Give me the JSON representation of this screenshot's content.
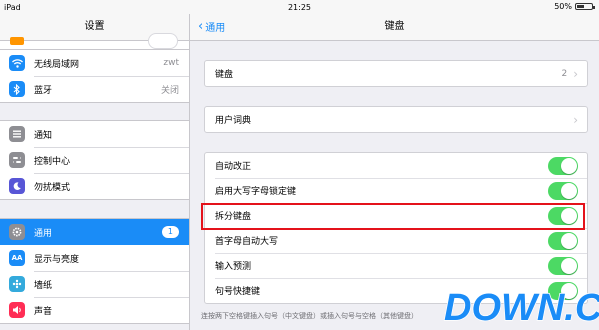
{
  "status": {
    "device": "iPad",
    "time": "21:25",
    "battery": "50%",
    "battery_level": 0.5
  },
  "sidebar": {
    "title": "设置",
    "items": [
      {
        "label": "无线局域网",
        "value": "zwt",
        "icon": "wifi-icon",
        "color": "#1a8cf7"
      },
      {
        "label": "蓝牙",
        "value": "关闭",
        "icon": "bluetooth-icon",
        "color": "#1a8cf7"
      },
      {
        "label": "通知",
        "icon": "notifications-icon",
        "color": "#8e8e93"
      },
      {
        "label": "控制中心",
        "icon": "control-center-icon",
        "color": "#8e8e93"
      },
      {
        "label": "勿扰模式",
        "icon": "moon-icon",
        "color": "#5856d6"
      },
      {
        "label": "通用",
        "badge": "1",
        "icon": "gear-icon",
        "color": "#8e8e93"
      },
      {
        "label": "显示与亮度",
        "icon": "display-icon",
        "color": "#1a8cf7"
      },
      {
        "label": "墙纸",
        "icon": "wallpaper-icon",
        "color": "#34aadc"
      },
      {
        "label": "声音",
        "icon": "sound-icon",
        "color": "#ff2d55"
      }
    ]
  },
  "detail": {
    "back_label": "通用",
    "title": "键盘",
    "keyboards": {
      "label": "键盘",
      "value": "2"
    },
    "dictionary": {
      "label": "用户词典"
    },
    "toggles": [
      {
        "label": "自动改正",
        "on": true
      },
      {
        "label": "启用大写字母锁定键",
        "on": true
      },
      {
        "label": "拆分键盘",
        "on": true
      },
      {
        "label": "首字母自动大写",
        "on": true
      },
      {
        "label": "输入预测",
        "on": true
      },
      {
        "label": "句号快捷键",
        "on": true
      }
    ],
    "footer": "连按两下空格键插入句号（中文键盘）或插入句号与空格（其他键盘）"
  },
  "watermark": {
    "text": "DOWN.CC",
    "colors": {
      "primary": "#ff7a00",
      "secondary": "#1a8cf7"
    }
  },
  "colors": {
    "accent": "#1a8cf7",
    "toggle_on": "#4cd964",
    "highlight": "#e4121b"
  }
}
